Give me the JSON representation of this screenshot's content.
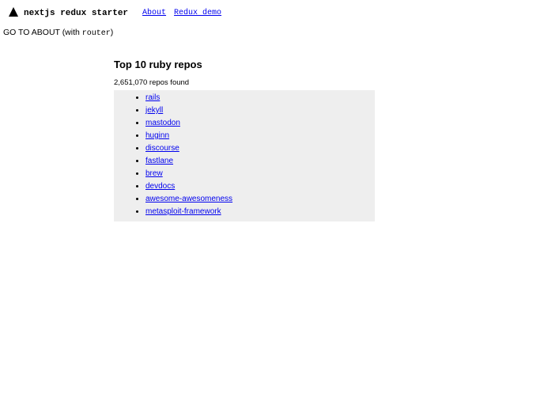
{
  "header": {
    "app_title": "nextjs redux starter",
    "nav": {
      "about": "About",
      "redux_demo": "Redux demo"
    }
  },
  "router_line": {
    "prefix": "GO TO ABOUT (with ",
    "code": "router",
    "suffix": ")"
  },
  "main": {
    "title": "Top 10 ruby repos",
    "subtitle": "2,651,070 repos found",
    "repos": [
      "rails",
      "jekyll",
      "mastodon",
      "huginn",
      "discourse",
      "fastlane",
      "brew",
      "devdocs",
      "awesome-awesomeness",
      "metasploit-framework"
    ]
  }
}
